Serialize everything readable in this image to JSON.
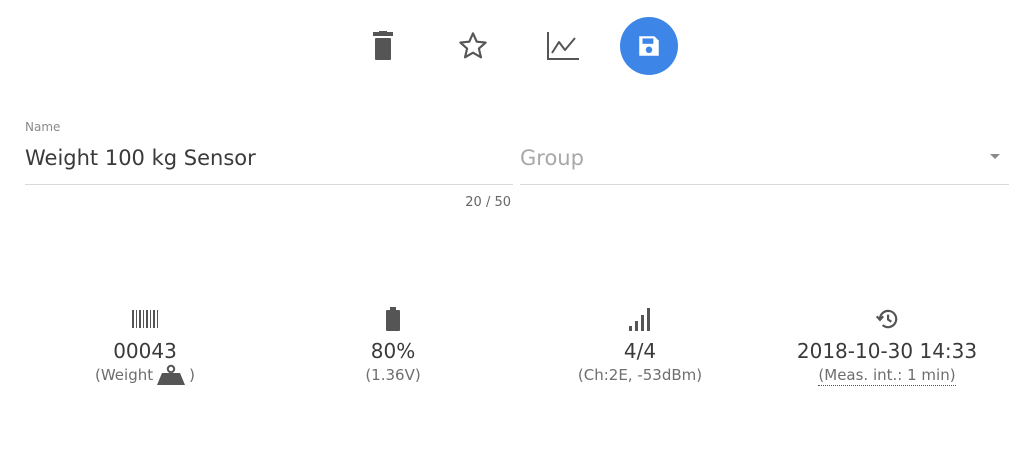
{
  "toolbar": {
    "icons": [
      "trash-icon",
      "star-outline-icon",
      "line-chart-icon",
      "save-icon"
    ],
    "accent_color": "#3d86e8"
  },
  "name_field": {
    "label": "Name",
    "value": "Weight 100 kg Sensor",
    "counter": "20 / 50"
  },
  "group_field": {
    "placeholder": "Group"
  },
  "stats": {
    "id": {
      "icon": "barcode-icon",
      "value": "00043",
      "sub_prefix": "(Weight",
      "sub_icon": "weight-icon",
      "sub_suffix": ")"
    },
    "battery": {
      "icon": "battery-icon",
      "value": "80%",
      "sub": "(1.36V)"
    },
    "signal": {
      "icon": "signal-bars-icon",
      "value": "4/4",
      "sub": "(Ch:2E, -53dBm)"
    },
    "time": {
      "icon": "history-icon",
      "value": "2018-10-30 14:33",
      "sub": "(Meas. int.: 1 min)"
    }
  }
}
